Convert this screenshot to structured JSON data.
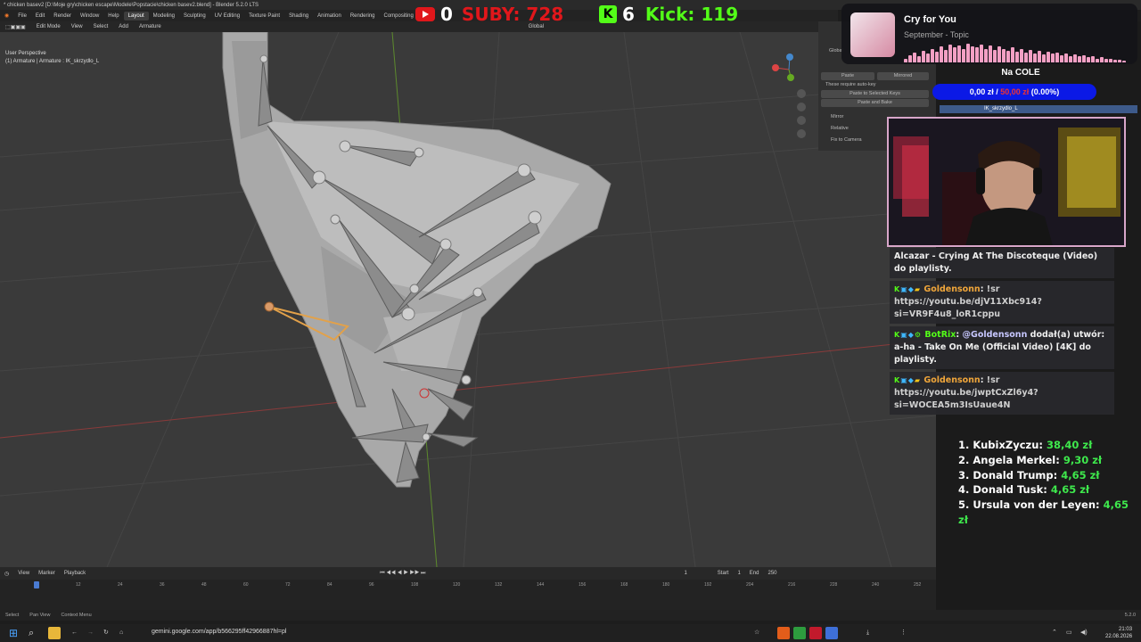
{
  "blender": {
    "title": "* chicken basev2 [D:\\Moje gry\\chicken escape\\Modele\\Popstacie\\chicken basev2.blend] - Blender 5.2.0 LTS",
    "menus": [
      "File",
      "Edit",
      "Render",
      "Window",
      "Help"
    ],
    "workspaces": [
      "Layout",
      "Modeling",
      "Sculpting",
      "UV Editing",
      "Texture Paint",
      "Shading",
      "Animation",
      "Rendering",
      "Compositing"
    ],
    "active_workspace": "Layout",
    "viewport_header": [
      "Edit Mode",
      "View",
      "Select",
      "Add",
      "Armature"
    ],
    "transform_orientation": "Global",
    "viewport_info": [
      "User Perspective",
      "(1) Armature | Armature : IK_skrzydlo_L"
    ],
    "properties": {
      "header": "Global",
      "paste_label": "Paste",
      "mirrored_label": "Mirrored",
      "hint": "These require auto-key",
      "paste_selected_keys": "Paste to Selected Keys",
      "paste_bake": "Paste and Bake",
      "options": [
        "Mirror",
        "Relative",
        "Fix to Camera"
      ]
    },
    "timeline": {
      "menus": [
        "View",
        "Marker",
        "Playback"
      ],
      "current_frame": "1",
      "start_label": "Start",
      "start": "1",
      "end_label": "End",
      "end": "250",
      "ticks": [
        "0",
        "12",
        "24",
        "36",
        "48",
        "60",
        "72",
        "84",
        "96",
        "108",
        "120",
        "132",
        "144",
        "156",
        "168",
        "180",
        "192",
        "204",
        "216",
        "228",
        "240",
        "252"
      ]
    },
    "statusbar": [
      "Select",
      "Pan View",
      "Context Menu"
    ],
    "version": "5.2.0"
  },
  "stream": {
    "youtube_count": "0",
    "subs_label": "SUBY: 728",
    "kick_count": "6",
    "kick_label": "Kick: 119"
  },
  "music": {
    "title": "Cry for You",
    "artist": "September - Topic",
    "eq_levels": [
      0.2,
      0.35,
      0.5,
      0.3,
      0.6,
      0.45,
      0.7,
      0.55,
      0.8,
      0.65,
      0.9,
      0.75,
      0.85,
      0.7,
      0.95,
      0.8,
      0.75,
      0.9,
      0.7,
      0.85,
      0.65,
      0.8,
      0.7,
      0.6,
      0.75,
      0.55,
      0.7,
      0.5,
      0.65,
      0.45,
      0.6,
      0.4,
      0.55,
      0.45,
      0.5,
      0.35,
      0.45,
      0.3,
      0.4,
      0.3,
      0.35,
      0.25,
      0.3,
      0.2,
      0.25,
      0.2,
      0.2,
      0.15,
      0.15,
      0.1
    ]
  },
  "donation_goal": {
    "title": "Na COLE",
    "current": "0,00 zł",
    "separator": " / ",
    "target": "50,00 zł",
    "percent": "(0.00%)",
    "progress": 0
  },
  "active_bone": "IK_skrzydlo_L",
  "chat": [
    {
      "user": "",
      "text": "Alcazar - Crying At The Discoteque (Video) do playlisty."
    },
    {
      "user": "Goldensonn",
      "text": "!sr https://youtu.be/djV11Xbc914?si=VR9F4u8_loR1cppu"
    },
    {
      "user": "BotRix",
      "mention": "@Goldensonn",
      "text": "dodał(a) utwór: a-ha - Take On Me (Official Video) [4K] do playlisty."
    },
    {
      "user": "Goldensonn",
      "text": "!sr https://youtu.be/jwptCxZl6y4?si=WOCEA5m3IsUaue4N"
    }
  ],
  "leaderboard": [
    {
      "rank": "1.",
      "name": "KubixZyczu:",
      "amount": "38,40 zł"
    },
    {
      "rank": "2.",
      "name": "Angela Merkel:",
      "amount": "9,30 zł"
    },
    {
      "rank": "3.",
      "name": "Donald Trump:",
      "amount": "4,65 zł"
    },
    {
      "rank": "4.",
      "name": "Donald Tusk:",
      "amount": "4,65 zł"
    },
    {
      "rank": "5.",
      "name": "Ursula von der Leyen:",
      "amount": "4,65 zł"
    }
  ],
  "browser": {
    "url": "gemini.google.com/app/b566295ff42966887hl=pl"
  },
  "clock": {
    "time": "21:03",
    "date": "22.08.2026"
  },
  "colors": {
    "youtube": "#e0171b",
    "kick": "#53fc18",
    "goal_bar": "#0b19e6",
    "leaderboard_amount": "#3ee84c",
    "chat_user": "#f0a63a"
  }
}
